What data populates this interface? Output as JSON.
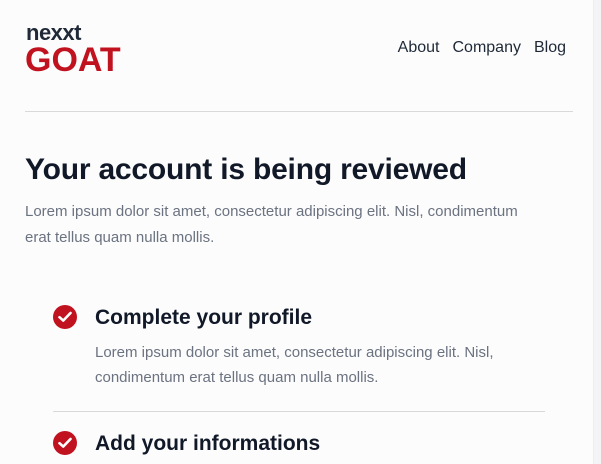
{
  "logo": {
    "top": "nexxt",
    "bottom": "GOAT"
  },
  "nav": {
    "items": [
      "About",
      "Company",
      "Blog"
    ]
  },
  "main": {
    "title": "Your account is being reviewed",
    "intro": "Lorem ipsum dolor sit amet, consectetur adipiscing elit. Nisl, condimentum erat tellus quam nulla mollis."
  },
  "steps": [
    {
      "title": "Complete your profile",
      "description": "Lorem ipsum dolor sit amet, consectetur adipiscing elit. Nisl, condimentum erat tellus quam nulla mollis.",
      "icon": "check-circle-icon"
    },
    {
      "title": "Add your informations",
      "icon": "check-circle-icon"
    }
  ],
  "colors": {
    "brand_red": "#c1121f",
    "text_dark": "#111827",
    "text_muted": "#6b7280",
    "divider": "#d9d9d9"
  }
}
